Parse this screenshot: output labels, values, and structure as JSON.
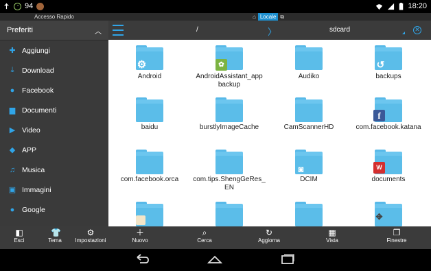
{
  "status_bar": {
    "battery_level": "94",
    "time": "18:20"
  },
  "title_strip": {
    "left": "Accesso Rapido",
    "location": "Locale"
  },
  "sidebar": {
    "header": "Preferiti",
    "items": [
      {
        "label": "Aggiungi",
        "icon": "plus-icon"
      },
      {
        "label": "Download",
        "icon": "download-icon"
      },
      {
        "label": "Facebook",
        "icon": "globe-icon"
      },
      {
        "label": "Documenti",
        "icon": "documents-icon"
      },
      {
        "label": "Video",
        "icon": "video-icon"
      },
      {
        "label": "APP",
        "icon": "app-icon"
      },
      {
        "label": "Musica",
        "icon": "music-icon"
      },
      {
        "label": "Immagini",
        "icon": "image-icon"
      },
      {
        "label": "Google",
        "icon": "globe-icon"
      }
    ],
    "bottom_buttons": [
      {
        "label": "Esci",
        "icon": "exit-icon"
      },
      {
        "label": "Tema",
        "icon": "shirt-icon"
      },
      {
        "label": "Impostazioni",
        "icon": "gear-icon"
      }
    ]
  },
  "toolbar": {
    "path_root": "/",
    "path_current": "sdcard"
  },
  "folders": [
    {
      "name": "Android",
      "badge": "gear"
    },
    {
      "name": "AndroidAssistant_app backup",
      "badge": "android"
    },
    {
      "name": "Audiko",
      "badge": ""
    },
    {
      "name": "backups",
      "badge": "backup"
    },
    {
      "name": "baidu",
      "badge": ""
    },
    {
      "name": "burstlyImageCache",
      "badge": ""
    },
    {
      "name": "CamScannerHD",
      "badge": ""
    },
    {
      "name": "com.facebook.katana",
      "badge": "facebook"
    },
    {
      "name": "com.facebook.orca",
      "badge": ""
    },
    {
      "name": "com.tips.ShengGeRes_ EN",
      "badge": ""
    },
    {
      "name": "DCIM",
      "badge": "camera"
    },
    {
      "name": "documents",
      "badge": "wps"
    },
    {
      "name": "",
      "badge": "image"
    },
    {
      "name": "",
      "badge": ""
    },
    {
      "name": "",
      "badge": ""
    },
    {
      "name": "",
      "badge": "gamepad"
    }
  ],
  "actions": [
    {
      "label": "Nuovo",
      "icon": "plus-icon"
    },
    {
      "label": "Cerca",
      "icon": "search-icon"
    },
    {
      "label": "Aggiorna",
      "icon": "refresh-icon"
    },
    {
      "label": "Vista",
      "icon": "grid-icon"
    },
    {
      "label": "Finestre",
      "icon": "windows-icon"
    }
  ],
  "colors": {
    "accent": "#30a5e8",
    "folder": "#5bbde9",
    "sidebar_bg": "#3a3a3a",
    "bar_bg": "#3b3b3b"
  }
}
